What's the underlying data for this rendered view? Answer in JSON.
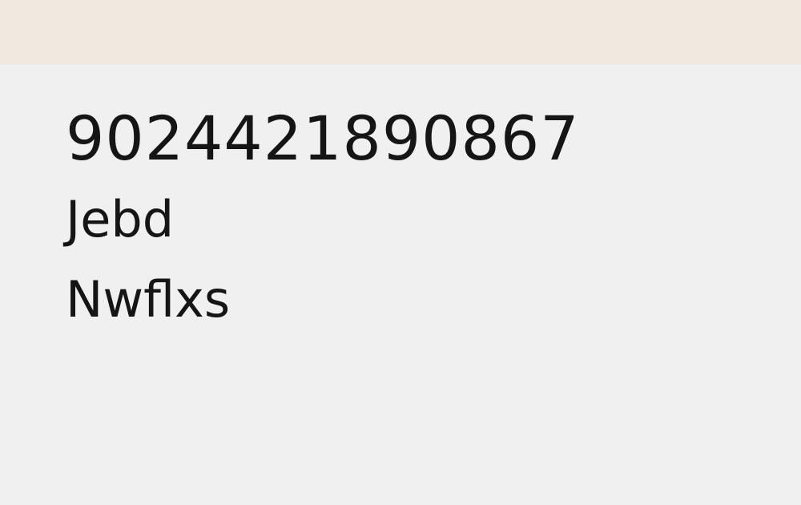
{
  "header": {
    "background": "#f1e8df"
  },
  "main": {
    "number": "9024421890867",
    "line1": "Jebd",
    "line2": "Nwflxs",
    "text_color": "#151515",
    "background": "#f0f0f0"
  }
}
